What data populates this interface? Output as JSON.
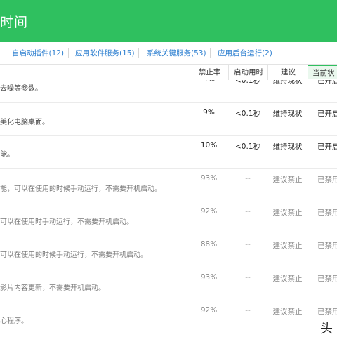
{
  "header": {
    "title": "时间",
    "color": "#2fc05f"
  },
  "tabs": [
    {
      "label": "自启动插件(12)"
    },
    {
      "label": "应用软件服务(15)"
    },
    {
      "label": "系统关键服务(53)"
    },
    {
      "label": "应用后台运行(2)"
    }
  ],
  "columns": {
    "ban_rate": "禁止率",
    "boot_time": "启动用时",
    "suggestion": "建议",
    "status": "当前状态"
  },
  "rows": [
    {
      "desc": "去噪等参数。",
      "ban_rate": "4%",
      "boot_time": "<0.1秒",
      "suggestion": "维持现状",
      "status": "已开启",
      "style": "bold"
    },
    {
      "desc": "美化电脑桌面。",
      "ban_rate": "9%",
      "boot_time": "<0.1秒",
      "suggestion": "维持现状",
      "status": "已开启",
      "style": "bold"
    },
    {
      "desc": "能。",
      "ban_rate": "10%",
      "boot_time": "<0.1秒",
      "suggestion": "维持现状",
      "status": "已开启",
      "style": "bold"
    },
    {
      "desc": "能，可以在使用的时候手动运行，不需要开机启动。",
      "ban_rate": "93%",
      "boot_time": "--",
      "suggestion": "建议禁止",
      "status": "已禁用",
      "style": "dim"
    },
    {
      "desc": "可以在使用时手动运行，不需要开机启动。",
      "ban_rate": "92%",
      "boot_time": "--",
      "suggestion": "建议禁止",
      "status": "已禁用",
      "style": "dim"
    },
    {
      "desc": "可以在使用的时候手动运行，不需要开机启动。",
      "ban_rate": "88%",
      "boot_time": "--",
      "suggestion": "建议禁止",
      "status": "已禁用",
      "style": "dim"
    },
    {
      "desc": "影片内容更新，不需要开机启动。",
      "ban_rate": "93%",
      "boot_time": "--",
      "suggestion": "建议禁止",
      "status": "已禁用",
      "style": "dim"
    },
    {
      "desc": "心程序。",
      "ban_rate": "92%",
      "boot_time": "--",
      "suggestion": "建议禁止",
      "status": "已禁用",
      "style": "dim"
    }
  ],
  "watermark": "头"
}
